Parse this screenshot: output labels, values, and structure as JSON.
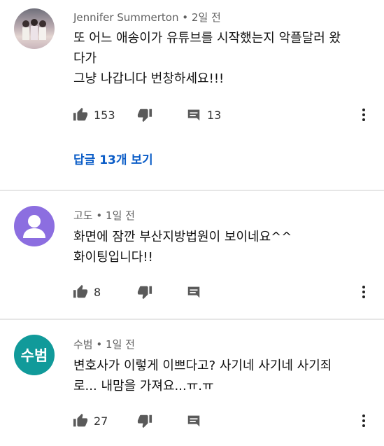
{
  "comments": [
    {
      "author": "Jennifer Summerton",
      "time": "2일 전",
      "lines": [
        "또 어느 애송이가 유튜브를 시작했는지 악플달러 왔",
        "다가",
        "그냥 나갑니다 번창하세요!!!"
      ],
      "likes": "153",
      "reply_count": "13",
      "view_replies": "답글 13개 보기",
      "avatar": "photo"
    },
    {
      "author": "고도",
      "time": "1일 전",
      "lines": [
        "화면에 잠깐 부산지방법원이 보이네요^^",
        "화이팅입니다!!"
      ],
      "likes": "8",
      "avatar": "default-person"
    },
    {
      "author": "수범",
      "time": "1일 전",
      "lines": [
        "변호사가 이렇게 이쁘다고? 사기네 사기네 사기죄",
        "로... 내맘을 가져요...ㅠ.ㅠ"
      ],
      "likes": "27",
      "avatar_initials": "수범"
    }
  ],
  "separator": "•",
  "colors": {
    "link": "#0a5cc7",
    "default_avatar": "#8c6ee0",
    "initials_avatar": "#119a9a"
  },
  "icons": [
    "thumb-up-icon",
    "thumb-down-icon",
    "reply-icon",
    "more-vert-icon"
  ]
}
